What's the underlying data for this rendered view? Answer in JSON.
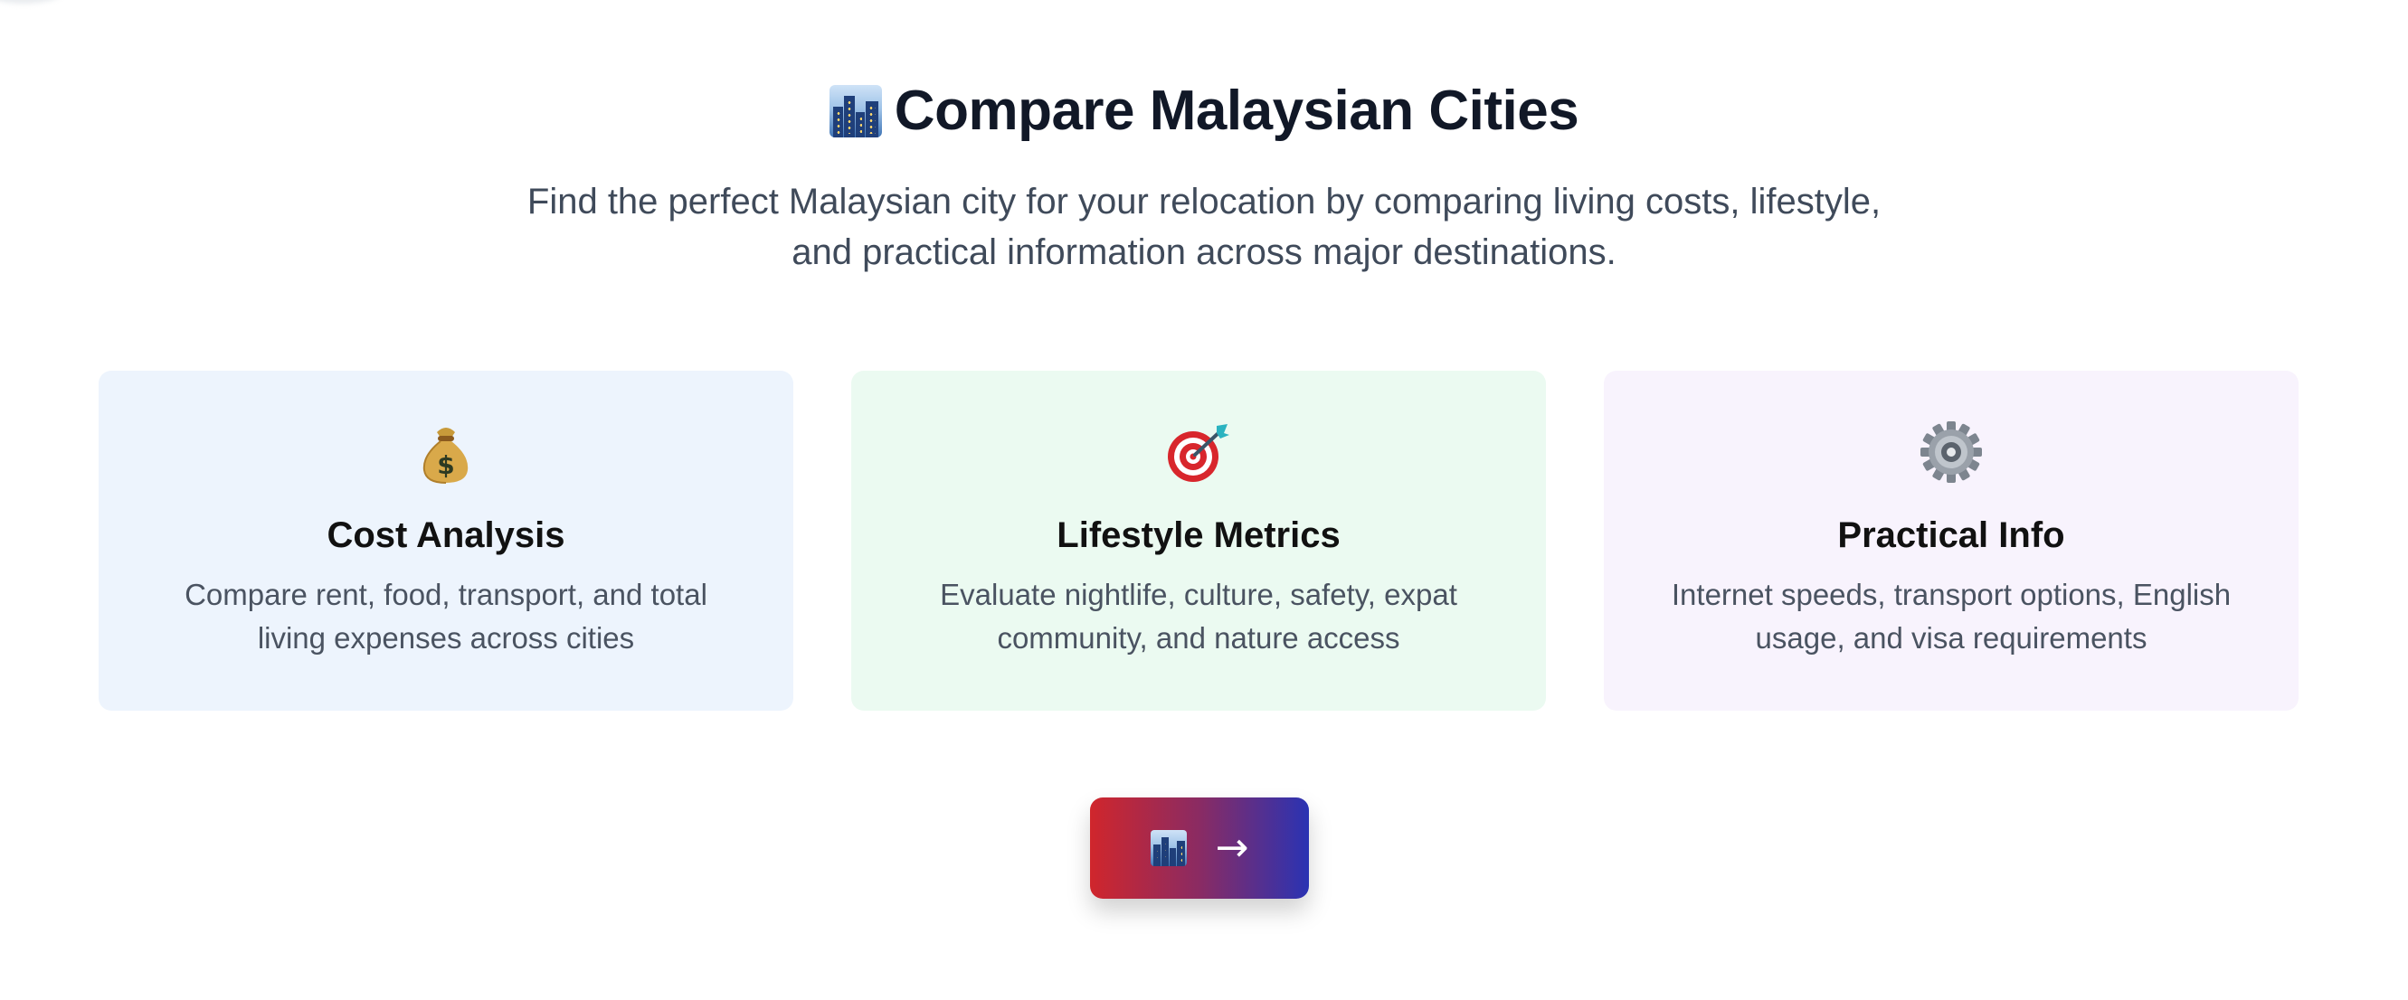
{
  "hero": {
    "title_icon": "city-skyline-icon",
    "title": "Compare Malaysian Cities",
    "subtitle": "Find the perfect Malaysian city for your relocation by comparing living costs, lifestyle, and practical information across major destinations."
  },
  "cards": [
    {
      "icon": "money-bag-icon",
      "title": "Cost Analysis",
      "description": "Compare rent, food, transport, and total living expenses across cities",
      "background": "#edf4fd"
    },
    {
      "icon": "target-icon",
      "title": "Lifestyle Metrics",
      "description": "Evaluate nightlife, culture, safety, expat community, and nature access",
      "background": "#ebfaf1"
    },
    {
      "icon": "gear-icon",
      "title": "Practical Info",
      "description": "Internet speeds, transport options, English usage, and visa requirements",
      "background": "#f8f3fd"
    }
  ],
  "cta": {
    "icon": "city-skyline-icon",
    "arrow_icon": "arrow-right-icon",
    "gradient": [
      "#d0262c",
      "#2a33b3"
    ]
  }
}
